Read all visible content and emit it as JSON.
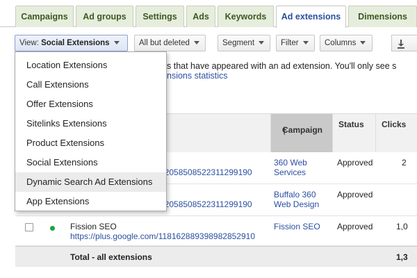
{
  "tabs": [
    {
      "label": "Campaigns"
    },
    {
      "label": "Ad groups"
    },
    {
      "label": "Settings"
    },
    {
      "label": "Ads"
    },
    {
      "label": "Keywords"
    },
    {
      "label": "Ad extensions",
      "active": true
    },
    {
      "label": "Dimensions"
    }
  ],
  "toolbar": {
    "view_prefix": "View: ",
    "view_value": "Social Extensions",
    "filter_status": "All but deleted",
    "segment": "Segment",
    "filter": "Filter",
    "columns": "Columns"
  },
  "info": {
    "text": "s that have appeared with an ad extension. You'll only see s",
    "link": "nsions statistics"
  },
  "dropdown": {
    "items": [
      "Location Extensions",
      "Call Extensions",
      "Offer Extensions",
      "Sitelinks Extensions",
      "Product Extensions",
      "Social Extensions",
      "Dynamic Search Ad Extensions",
      "App Extensions"
    ],
    "hovered_index": 6
  },
  "table": {
    "headers": {
      "campaign": "Campaign",
      "status": "Status",
      "clicks": "Clicks"
    },
    "sort_arrow": "🡑",
    "rows": [
      {
        "url_tail": "120585085223112991​90",
        "campaign_line1": "360 Web",
        "campaign_line2": "Services",
        "status": "Approved",
        "clicks": "2"
      },
      {
        "url_tail": "120585085223112991​90",
        "campaign_line1": "Buffalo 360",
        "campaign_line2": "Web Design",
        "status": "Approved",
        "clicks": ""
      },
      {
        "name": "Fission SEO",
        "url": "https://plus.google.com/118162889398982852910",
        "campaign_line1": "Fission SEO",
        "status": "Approved",
        "clicks": "1,0"
      }
    ],
    "total": {
      "label": "Total - all extensions",
      "clicks": "1,3"
    }
  },
  "colors": {
    "accent_link": "#2a4fa0",
    "status_dot": "#1ea442",
    "tab_bg": "#e7eddc"
  }
}
